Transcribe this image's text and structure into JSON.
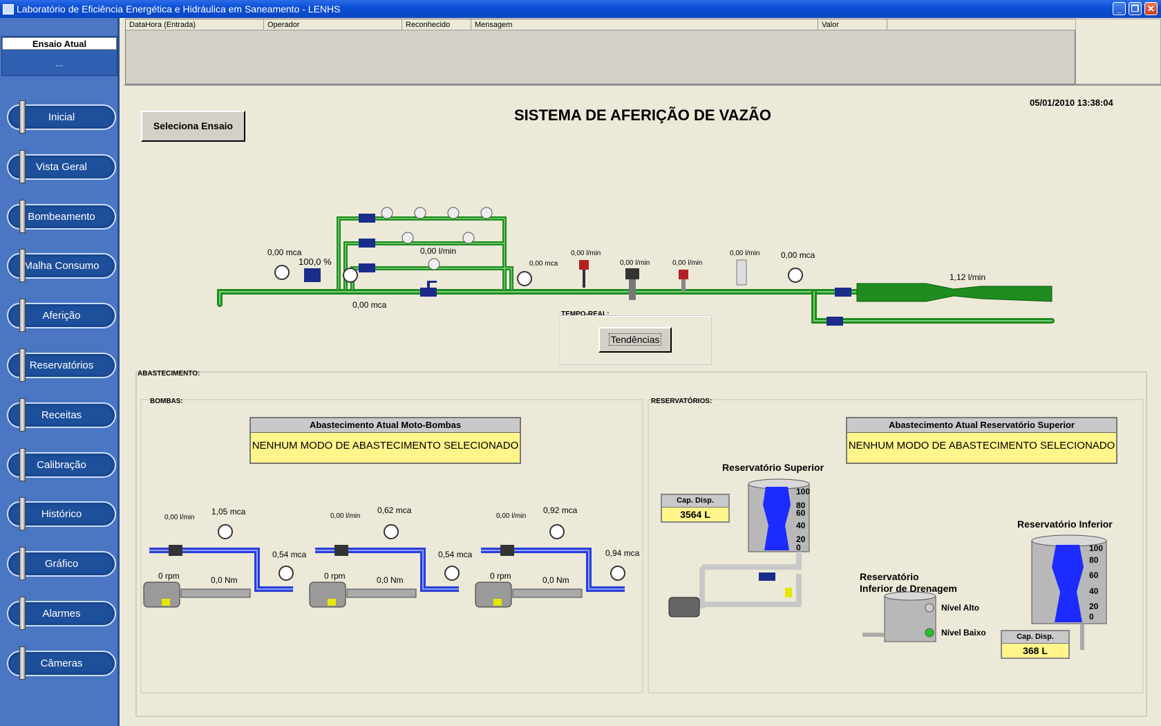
{
  "window": {
    "title": "Laboratório de Eficiência Energética e Hidráulica em Saneamento - LENHS",
    "minimize_glyph": "_",
    "restore_glyph": "❐",
    "close_glyph": "✕"
  },
  "sidebar": {
    "ensaio_label": "Ensaio Atual",
    "ensaio_value": "...",
    "items": [
      {
        "label": "Inicial"
      },
      {
        "label": "Vista Geral"
      },
      {
        "label": "Bombeamento"
      },
      {
        "label": "Malha Consumo"
      },
      {
        "label": "Aferição"
      },
      {
        "label": "Reservatórios"
      },
      {
        "label": "Receitas"
      },
      {
        "label": "Calibração"
      },
      {
        "label": "Histórico"
      },
      {
        "label": "Gráfico"
      },
      {
        "label": "Alarmes"
      },
      {
        "label": "Câmeras"
      }
    ]
  },
  "alarms": {
    "columns": [
      "DataHora (Entrada)",
      "Operador",
      "Reconhecido",
      "Mensagem",
      "Valor"
    ]
  },
  "main": {
    "datetime": "05/01/2010 13:38:04",
    "title": "SISTEMA DE AFERIÇÃO DE VAZÃO",
    "seleciona_button": "Seleciona Ensaio",
    "tempo_real_label": "TEMPO-REAL:",
    "tendencias_button": "Tendências"
  },
  "diagram": {
    "pressure_left": "0,00 mca",
    "valve_percent": "100,0 %",
    "pressure_bottom": "0,00 mca",
    "branch_flow": "0,00 l/min",
    "pressure_mid": "0,00 mca",
    "flow_1": "0,00 l/min",
    "flow_2": "0,00 l/min",
    "flow_3": "0,00 l/min",
    "flow_4": "0,00 l/min",
    "pressure_right": "0,00 mca",
    "outlet_flow": "1,12 l/min"
  },
  "abastecimento": {
    "label": "ABASTECIMENTO:",
    "bombas_label": "BOMBAS:",
    "reservatorios_label": "RESERVATÓRIOS:",
    "pump_panel_title": "Abastecimento Atual Moto-Bombas",
    "pump_panel_value": "NENHUM MODO DE ABASTECIMENTO SELECIONADO",
    "res_panel_title": "Abastecimento Atual Reservatório Superior",
    "res_panel_value": "NENHUM MODO DE ABASTECIMENTO SELECIONADO",
    "pumps": [
      {
        "flow": "0,00 l/min",
        "pressure_in": "1,05 mca",
        "pressure_out": "0,54 mca",
        "rpm": "0 rpm",
        "torque": "0,0 Nm"
      },
      {
        "flow": "0,00 l/min",
        "pressure_in": "0,62 mca",
        "pressure_out": "0,54 mca",
        "rpm": "0 rpm",
        "torque": "0,0 Nm"
      },
      {
        "flow": "0,00 l/min",
        "pressure_in": "0,92 mca",
        "pressure_out": "0,94 mca",
        "rpm": "0 rpm",
        "torque": "0,0 Nm"
      }
    ],
    "superior": {
      "title": "Reservatório Superior",
      "cap_label": "Cap. Disp.",
      "cap_value": "3564 L",
      "scale": [
        "100",
        "80",
        "60",
        "40",
        "20",
        "0"
      ]
    },
    "drenagem": {
      "title_line1": "Reservatório",
      "title_line2": "Inferior de Drenagem",
      "nivel_alto": "Nível Alto",
      "nivel_baixo": "Nível Baixo"
    },
    "inferior": {
      "title": "Reservatório Inferior",
      "cap_label": "Cap. Disp.",
      "cap_value": "368 L",
      "scale": [
        "100",
        "80",
        "60",
        "40",
        "20",
        "0"
      ]
    }
  },
  "colors": {
    "pipe_green": "#1e8c1e",
    "pipe_blue": "#2a3fd8",
    "sidebar_bg": "#4a76c3",
    "panel_yellow": "#fff58a"
  }
}
